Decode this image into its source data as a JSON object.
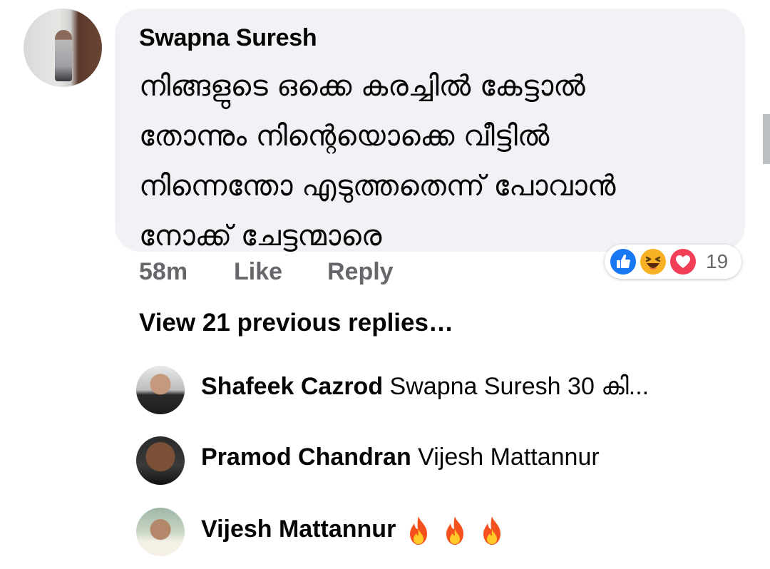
{
  "comment": {
    "author": "Swapna Suresh",
    "lines": [
      "നിങ്ങളുടെ ഒക്കെ കരച്ചിൽ കേട്ടാൽ",
      "തോന്നും നിന്റെയൊക്കെ വീട്ടിൽ",
      "നിന്നെന്തോ എടുത്തതെന്ന് പോവാൻ",
      "നോക്ക് ചേട്ടന്മാരെ"
    ],
    "time": "58m",
    "like_label": "Like",
    "reply_label": "Reply",
    "reaction_count": "19",
    "reaction_icons": [
      "like-icon",
      "haha-icon",
      "love-icon"
    ]
  },
  "view_previous": "View 21 previous replies…",
  "replies": [
    {
      "name": "Shafeek Cazrod",
      "snippet": "Swapna Suresh 30 കി..."
    },
    {
      "name": "Pramod Chandran",
      "snippet": "Vijesh Mattannur"
    },
    {
      "name": "Vijesh Mattannur",
      "snippet": "",
      "emoji": [
        "fire-icon",
        "fire-icon",
        "fire-icon"
      ]
    }
  ],
  "colors": {
    "bubble": "#f0f2f5",
    "meta_text": "#65676b",
    "like_blue": "#1877f2",
    "haha_yellow": "#f7b125",
    "love_red": "#f33e58"
  }
}
